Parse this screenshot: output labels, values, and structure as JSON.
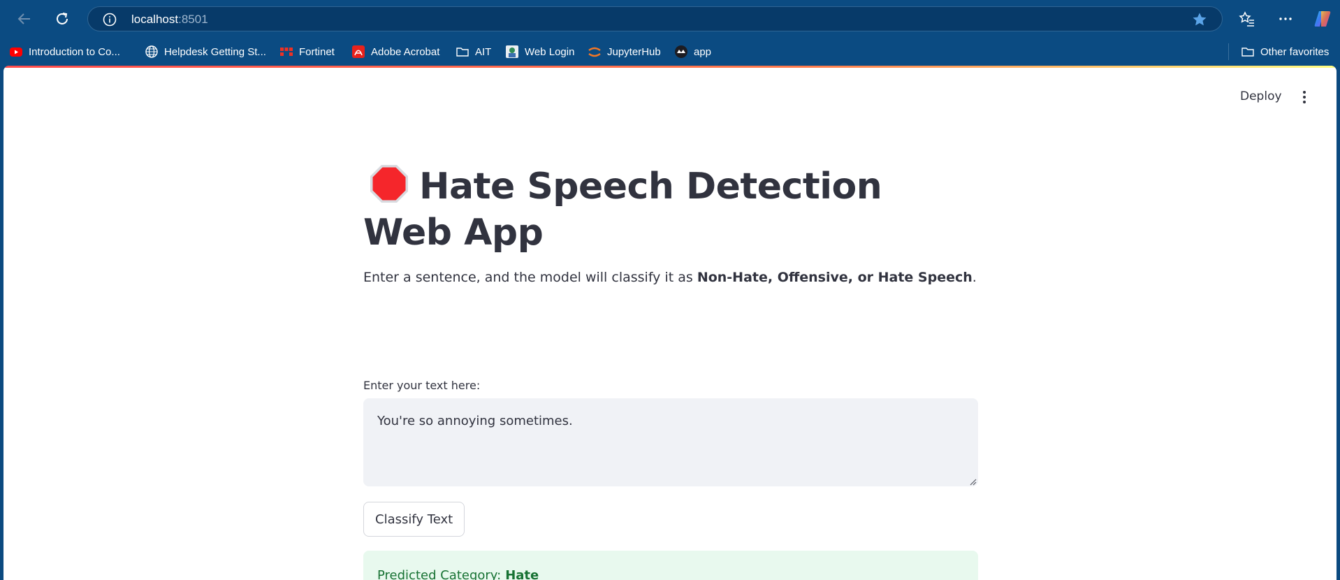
{
  "browser": {
    "url_host": "localhost",
    "url_port": ":8501",
    "bookmarks": [
      {
        "label": "Introduction to Co...",
        "icon": "youtube-icon"
      },
      {
        "label": "Helpdesk Getting St...",
        "icon": "globe-icon"
      },
      {
        "label": "Fortinet",
        "icon": "fortinet-icon"
      },
      {
        "label": "Adobe Acrobat",
        "icon": "acrobat-icon"
      },
      {
        "label": "AIT",
        "icon": "folder-icon"
      },
      {
        "label": "Web Login",
        "icon": "web-login-icon"
      },
      {
        "label": "JupyterHub",
        "icon": "jupyter-icon"
      },
      {
        "label": "app",
        "icon": "streamlit-icon"
      }
    ],
    "other_favorites": "Other favorites"
  },
  "app": {
    "deploy_label": "Deploy",
    "title": "Hate Speech Detection Web App",
    "title_icon": "stop-sign-icon",
    "subtitle_prefix": "Enter a sentence, and the model will classify it as ",
    "subtitle_bold": "Non-Hate, Offensive, or Hate Speech",
    "subtitle_suffix": ".",
    "input_label": "Enter your text here:",
    "input_value": "You're so annoying sometimes.",
    "button_label": "Classify Text",
    "result_prefix": "Predicted Category:",
    "result_value": "Hate"
  },
  "colors": {
    "chrome": "#0b4b82",
    "accent": "#ff4b4b",
    "success_bg": "#e8f9ee",
    "success_text": "#177233"
  }
}
